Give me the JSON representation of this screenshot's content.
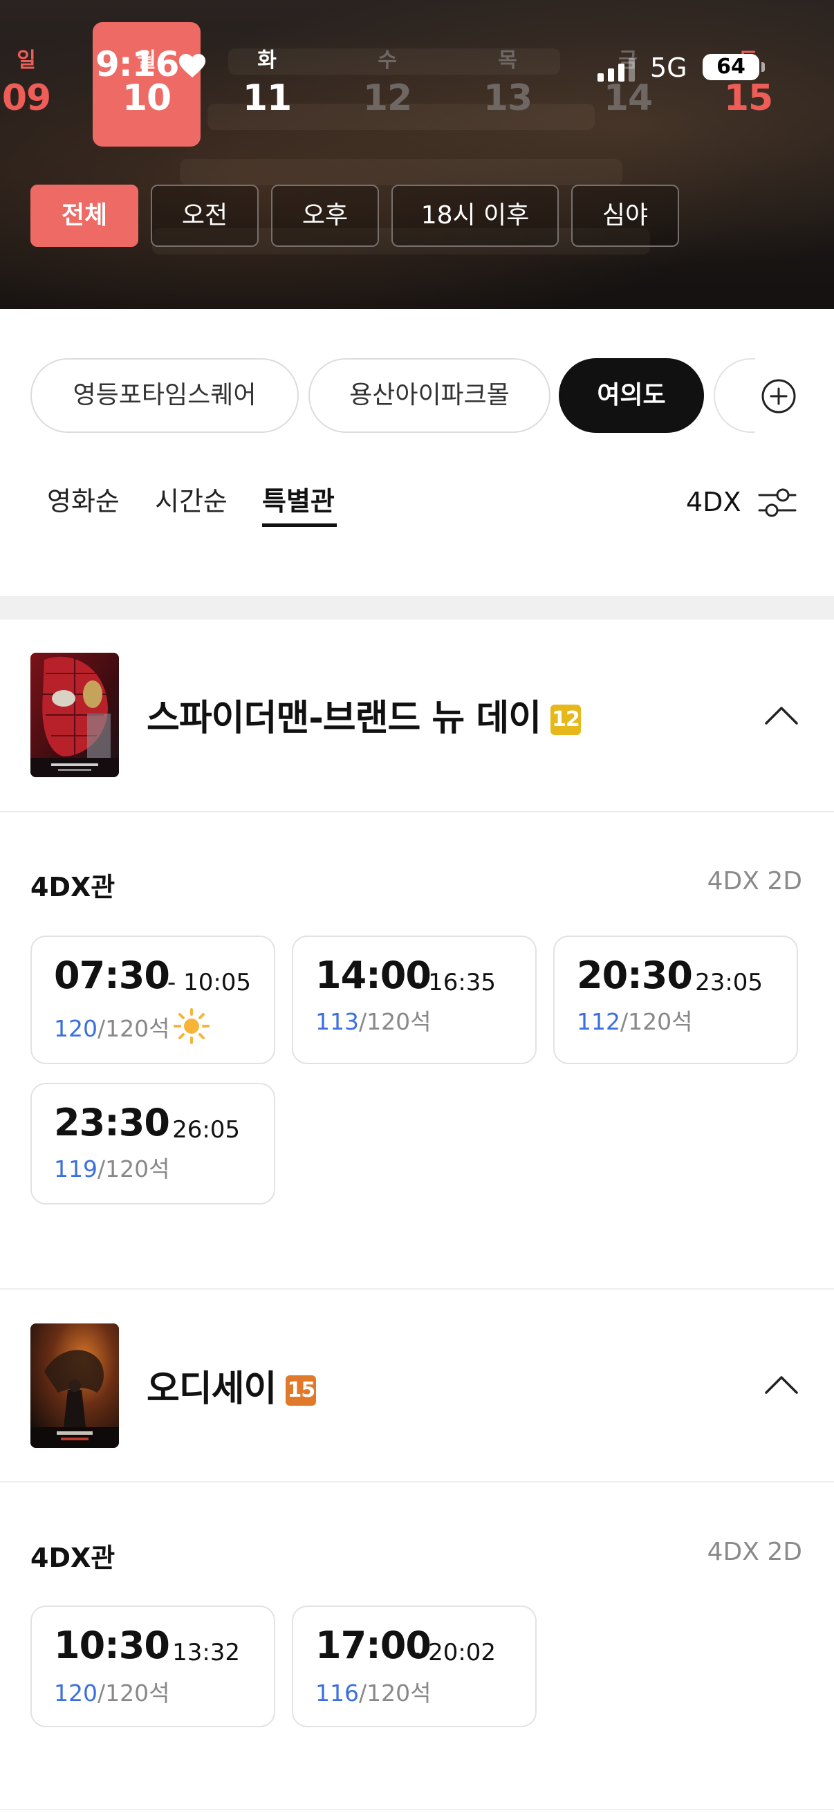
{
  "status_bar": {
    "time": "9:16",
    "network": "5G",
    "battery": "64"
  },
  "dates": [
    {
      "dow": "일",
      "num": "09",
      "state": "sunday"
    },
    {
      "dow": "월",
      "num": "10",
      "state": "selected"
    },
    {
      "dow": "화",
      "num": "11",
      "state": "normal"
    },
    {
      "dow": "수",
      "num": "12",
      "state": "disabled"
    },
    {
      "dow": "목",
      "num": "13",
      "state": "disabled"
    },
    {
      "dow": "금",
      "num": "14",
      "state": "disabled"
    },
    {
      "dow": "토",
      "num": "15",
      "state": "saturday"
    }
  ],
  "time_filters": [
    "전체",
    "오전",
    "오후",
    "18시 이후",
    "심야"
  ],
  "theaters": [
    "영등포타임스퀘어",
    "용산아이파크몰",
    "여의도"
  ],
  "sort_tabs": [
    "영화순",
    "시간순",
    "특별관"
  ],
  "filter_label": "4DX",
  "colors": {
    "accent": "#ee6a64",
    "seat_available": "#3b6fe0",
    "age12": "#e6b81c",
    "age15": "#e07a2a"
  },
  "movies": [
    {
      "title": "스파이더맨-브랜드 뉴 데이",
      "age": "12",
      "hall": "4DX관",
      "format": "4DX 2D",
      "showtimes": [
        {
          "start": "07:30",
          "end": "- 10:05",
          "available": "120",
          "total": "/120석",
          "morning": true
        },
        {
          "start": "14:00",
          "end": "- 16:35",
          "available": "113",
          "total": "/120석"
        },
        {
          "start": "20:30",
          "end": "- 23:05",
          "available": "112",
          "total": "/120석"
        },
        {
          "start": "23:30",
          "end": "- 26:05",
          "available": "119",
          "total": "/120석"
        }
      ]
    },
    {
      "title": "오디세이",
      "age": "15",
      "hall": "4DX관",
      "format": "4DX 2D",
      "showtimes": [
        {
          "start": "10:30",
          "end": "- 13:32",
          "available": "120",
          "total": "/120석"
        },
        {
          "start": "17:00",
          "end": "- 20:02",
          "available": "116",
          "total": "/120석"
        }
      ]
    }
  ]
}
